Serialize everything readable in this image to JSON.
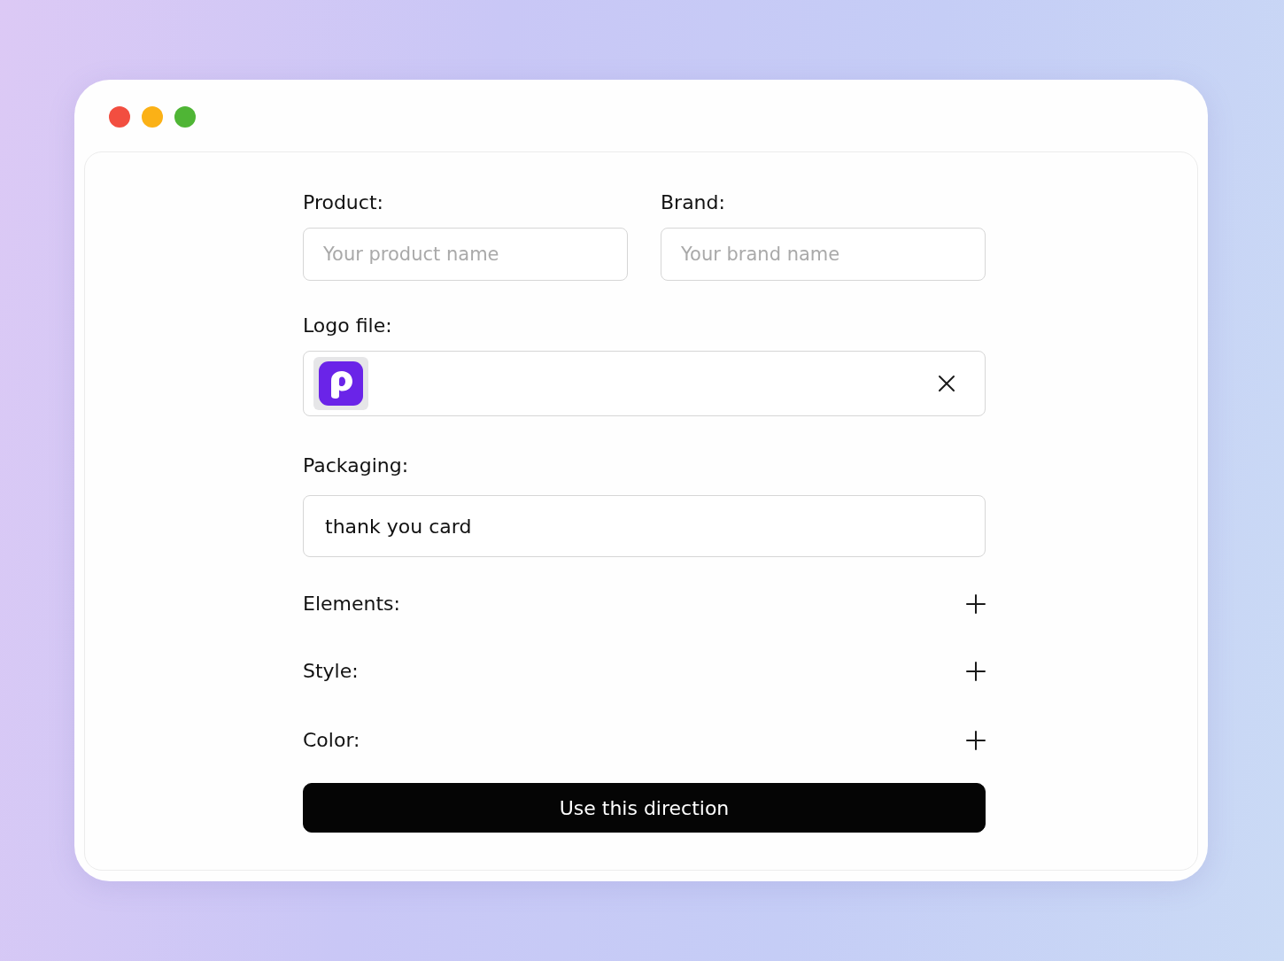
{
  "window": {
    "controls": [
      {
        "color": "#f24e40"
      },
      {
        "color": "#fbb116"
      },
      {
        "color": "#4fb535"
      }
    ]
  },
  "product": {
    "label": "Product:",
    "placeholder": "Your product name"
  },
  "brand": {
    "label": "Brand:",
    "placeholder": "Your brand name"
  },
  "logo_file": {
    "label": "Logo file:"
  },
  "packaging": {
    "label": "Packaging:",
    "value": "thank you card"
  },
  "sections": [
    {
      "label": "Elements:",
      "expanded": false
    },
    {
      "label": "Style:",
      "expanded": false
    },
    {
      "label": "Color:",
      "expanded": false
    }
  ],
  "button": {
    "label": "Use this direction"
  }
}
